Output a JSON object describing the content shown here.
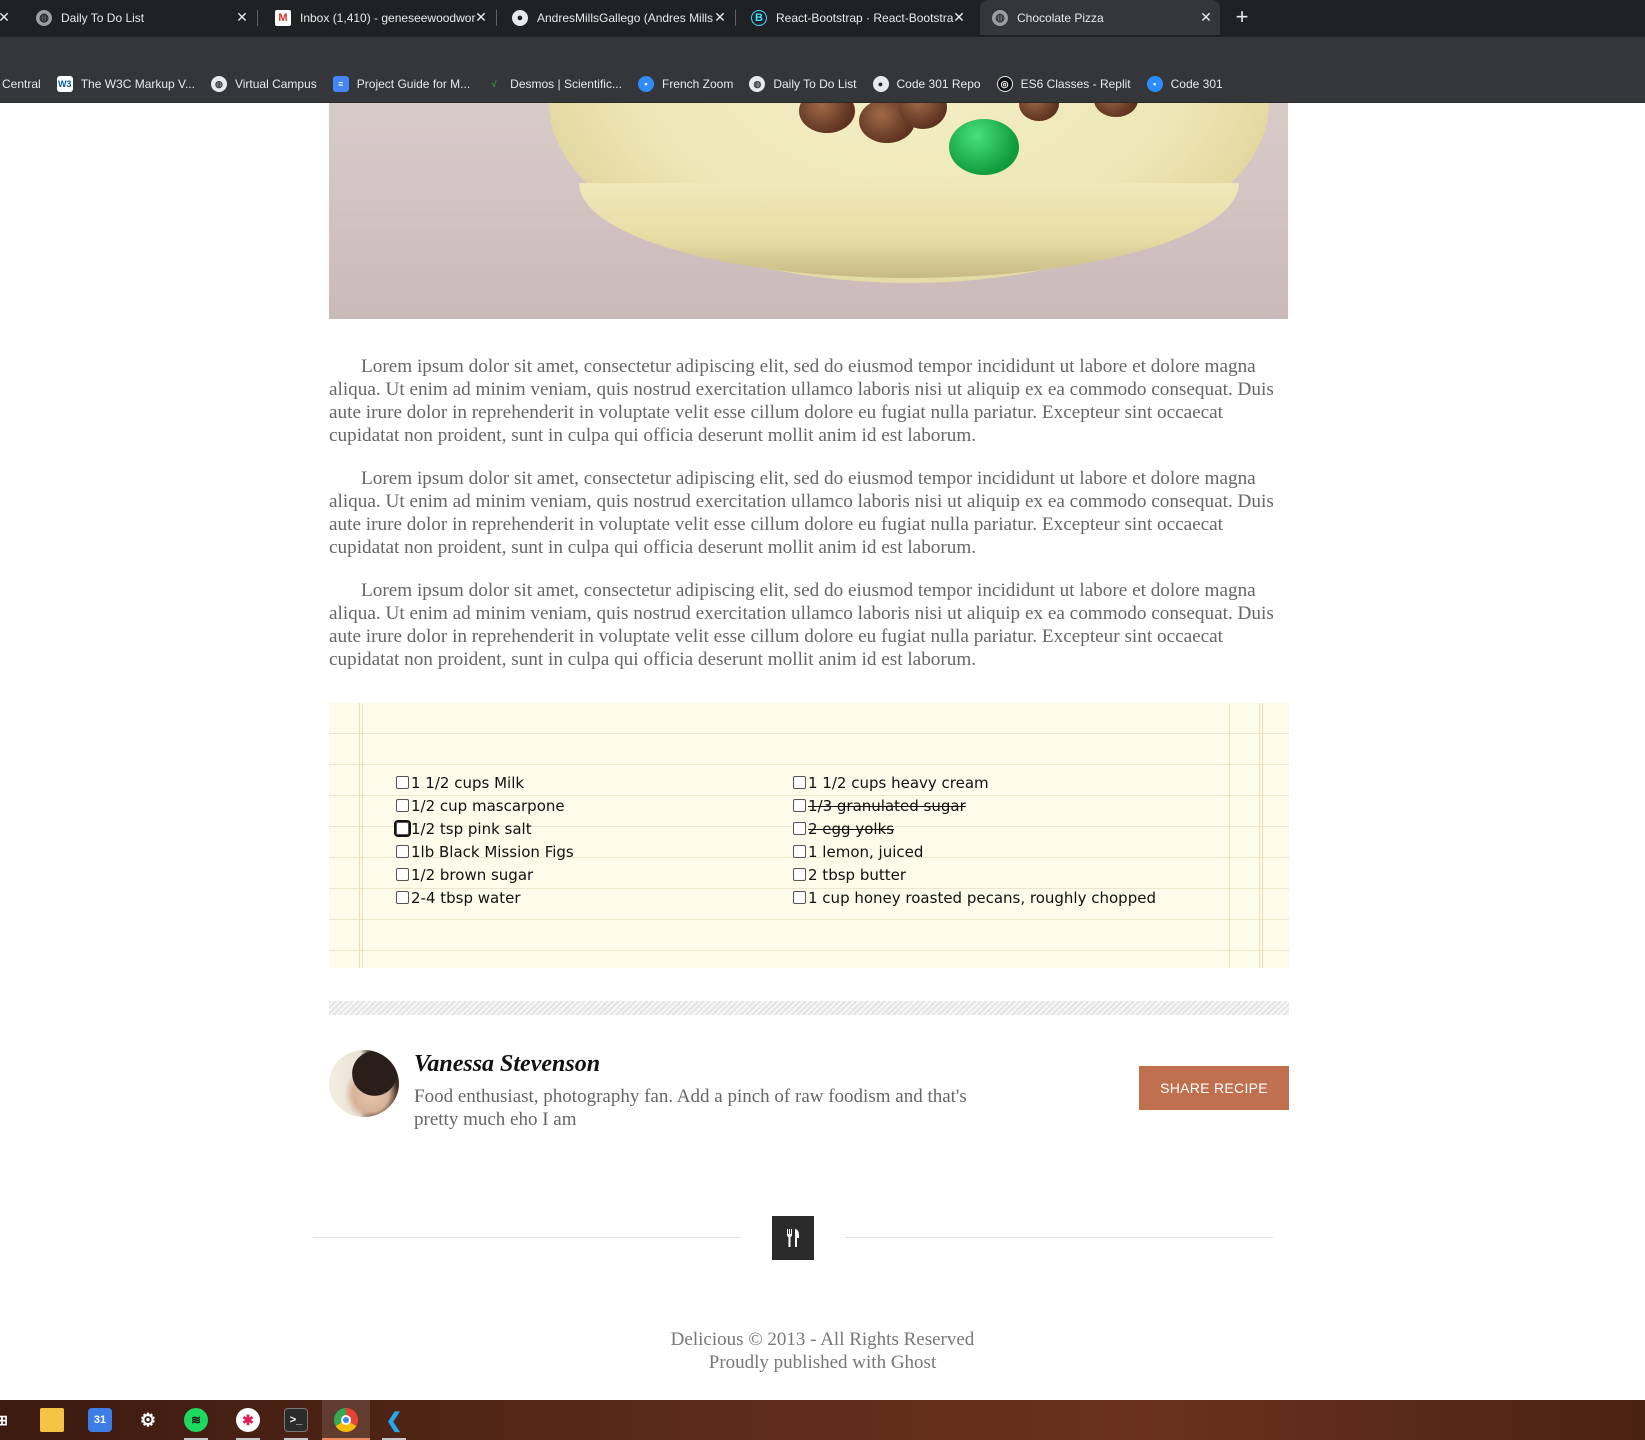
{
  "tabs": [
    {
      "title": "Daily To Do List",
      "icon": "globe-icon",
      "active": false
    },
    {
      "title": "Inbox (1,410) - geneseewoodwor",
      "icon": "gmail-icon",
      "active": false
    },
    {
      "title": "AndresMillsGallego (Andres Mills",
      "icon": "github-icon",
      "active": false
    },
    {
      "title": "React-Bootstrap · React-Bootstra",
      "icon": "react-bootstrap-icon",
      "active": false
    },
    {
      "title": "Chocolate Pizza",
      "icon": "globe-icon",
      "active": true
    }
  ],
  "new_tab_label": "+",
  "bookmarks": [
    {
      "label": "Central",
      "icon": ""
    },
    {
      "label": "The W3C Markup V...",
      "icon": "w3c-icon"
    },
    {
      "label": "Virtual Campus",
      "icon": "globe-icon"
    },
    {
      "label": "Project Guide for M...",
      "icon": "docs-icon"
    },
    {
      "label": "Desmos | Scientific...",
      "icon": "desmos-icon"
    },
    {
      "label": "French Zoom",
      "icon": "zoom-icon"
    },
    {
      "label": "Daily To Do List",
      "icon": "globe-icon"
    },
    {
      "label": "Code 301 Repo",
      "icon": "github-icon"
    },
    {
      "label": "ES6 Classes - Replit",
      "icon": "replit-icon"
    },
    {
      "label": "Code 301",
      "icon": "zoom-icon"
    }
  ],
  "article": {
    "paragraphs": [
      "Lorem ipsum dolor sit amet, consectetur adipiscing elit, sed do eiusmod tempor incididunt ut labore et dolore magna aliqua. Ut enim ad minim veniam, quis nostrud exercitation ullamco laboris nisi ut aliquip ex ea commodo consequat. Duis aute irure dolor in reprehenderit in voluptate velit esse cillum dolore eu fugiat nulla pariatur. Excepteur sint occaecat cupidatat non proident, sunt in culpa qui officia deserunt mollit anim id est laborum.",
      "Lorem ipsum dolor sit amet, consectetur adipiscing elit, sed do eiusmod tempor incididunt ut labore et dolore magna aliqua. Ut enim ad minim veniam, quis nostrud exercitation ullamco laboris nisi ut aliquip ex ea commodo consequat. Duis aute irure dolor in reprehenderit in voluptate velit esse cillum dolore eu fugiat nulla pariatur. Excepteur sint occaecat cupidatat non proident, sunt in culpa qui officia deserunt mollit anim id est laborum.",
      "Lorem ipsum dolor sit amet, consectetur adipiscing elit, sed do eiusmod tempor incididunt ut labore et dolore magna aliqua. Ut enim ad minim veniam, quis nostrud exercitation ullamco laboris nisi ut aliquip ex ea commodo consequat. Duis aute irure dolor in reprehenderit in voluptate velit esse cillum dolore eu fugiat nulla pariatur. Excepteur sint occaecat cupidatat non proident, sunt in culpa qui officia deserunt mollit anim id est laborum."
    ]
  },
  "ingredients": {
    "left": [
      {
        "label": "1 1/2 cups Milk",
        "checked": false,
        "struck": false
      },
      {
        "label": "1/2 cup mascarpone",
        "checked": false,
        "struck": false
      },
      {
        "label": "1/2 tsp pink salt",
        "checked": false,
        "struck": false,
        "focused": true
      },
      {
        "label": "1lb Black Mission Figs",
        "checked": false,
        "struck": false
      },
      {
        "label": "1/2 brown sugar",
        "checked": false,
        "struck": false
      },
      {
        "label": "2-4 tbsp water",
        "checked": false,
        "struck": false
      }
    ],
    "right": [
      {
        "label": "1 1/2 cups heavy cream",
        "checked": false,
        "struck": false
      },
      {
        "label": "1/3 granulated sugar",
        "checked": false,
        "struck": true
      },
      {
        "label": "2 egg yolks",
        "checked": false,
        "struck": true
      },
      {
        "label": "1 lemon, juiced",
        "checked": false,
        "struck": false
      },
      {
        "label": "2 tbsp butter",
        "checked": false,
        "struck": false
      },
      {
        "label": "1 cup honey roasted pecans, roughly chopped",
        "checked": false,
        "struck": false
      }
    ]
  },
  "author": {
    "name": "Vanessa Stevenson",
    "bio": "Food enthusiast, photography fan. Add a pinch of raw foodism and that's pretty much eho I am",
    "share_label": "SHARE RECIPE"
  },
  "footer": {
    "icon": "fork-knife-icon",
    "copyright": "Delicious © 2013 - All Rights Reserved",
    "published": "Proudly published with Ghost"
  },
  "taskbar": [
    {
      "icon": "start-icon"
    },
    {
      "icon": "file-explorer-icon"
    },
    {
      "icon": "calendar-icon",
      "text": "31"
    },
    {
      "icon": "steam-icon"
    },
    {
      "icon": "spotify-icon"
    },
    {
      "icon": "slack-icon"
    },
    {
      "icon": "terminal-icon"
    },
    {
      "icon": "chrome-icon",
      "active": true
    },
    {
      "icon": "vscode-icon"
    }
  ],
  "colors": {
    "accent": "#c0704f",
    "notebook_bg": "#fdfbea",
    "chrome_dark": "#202124",
    "chrome_mid": "#35363a"
  }
}
